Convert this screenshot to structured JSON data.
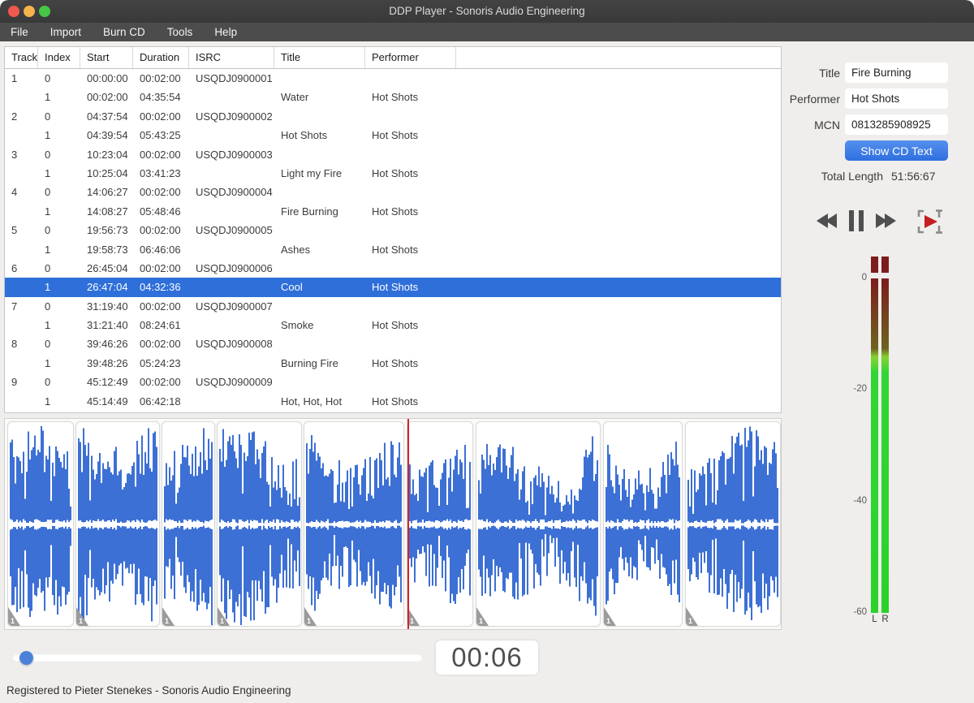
{
  "window": {
    "title": "DDP Player - Sonoris Audio Engineering"
  },
  "menu": {
    "items": [
      "File",
      "Import",
      "Burn CD",
      "Tools",
      "Help"
    ]
  },
  "table": {
    "columns": [
      "Track",
      "Index",
      "Start",
      "Duration",
      "ISRC",
      "Title",
      "Performer"
    ],
    "rows": [
      {
        "track": "1",
        "index": "0",
        "start": "00:00:00",
        "duration": "00:02:00",
        "isrc": "USQDJ0900001",
        "title": "",
        "performer": "",
        "selected": false
      },
      {
        "track": "",
        "index": "1",
        "start": "00:02:00",
        "duration": "04:35:54",
        "isrc": "",
        "title": "Water",
        "performer": "Hot Shots",
        "selected": false
      },
      {
        "track": "2",
        "index": "0",
        "start": "04:37:54",
        "duration": "00:02:00",
        "isrc": "USQDJ0900002",
        "title": "",
        "performer": "",
        "selected": false
      },
      {
        "track": "",
        "index": "1",
        "start": "04:39:54",
        "duration": "05:43:25",
        "isrc": "",
        "title": "Hot Shots",
        "performer": "Hot Shots",
        "selected": false
      },
      {
        "track": "3",
        "index": "0",
        "start": "10:23:04",
        "duration": "00:02:00",
        "isrc": "USQDJ0900003",
        "title": "",
        "performer": "",
        "selected": false
      },
      {
        "track": "",
        "index": "1",
        "start": "10:25:04",
        "duration": "03:41:23",
        "isrc": "",
        "title": "Light my Fire",
        "performer": "Hot Shots",
        "selected": false
      },
      {
        "track": "4",
        "index": "0",
        "start": "14:06:27",
        "duration": "00:02:00",
        "isrc": "USQDJ0900004",
        "title": "",
        "performer": "",
        "selected": false
      },
      {
        "track": "",
        "index": "1",
        "start": "14:08:27",
        "duration": "05:48:46",
        "isrc": "",
        "title": "Fire Burning",
        "performer": "Hot Shots",
        "selected": false
      },
      {
        "track": "5",
        "index": "0",
        "start": "19:56:73",
        "duration": "00:02:00",
        "isrc": "USQDJ0900005",
        "title": "",
        "performer": "",
        "selected": false
      },
      {
        "track": "",
        "index": "1",
        "start": "19:58:73",
        "duration": "06:46:06",
        "isrc": "",
        "title": "Ashes",
        "performer": "Hot Shots",
        "selected": false
      },
      {
        "track": "6",
        "index": "0",
        "start": "26:45:04",
        "duration": "00:02:00",
        "isrc": "USQDJ0900006",
        "title": "",
        "performer": "",
        "selected": false
      },
      {
        "track": "",
        "index": "1",
        "start": "26:47:04",
        "duration": "04:32:36",
        "isrc": "",
        "title": "Cool",
        "performer": "Hot Shots",
        "selected": true
      },
      {
        "track": "7",
        "index": "0",
        "start": "31:19:40",
        "duration": "00:02:00",
        "isrc": "USQDJ0900007",
        "title": "",
        "performer": "",
        "selected": false
      },
      {
        "track": "",
        "index": "1",
        "start": "31:21:40",
        "duration": "08:24:61",
        "isrc": "",
        "title": "Smoke",
        "performer": "Hot Shots",
        "selected": false
      },
      {
        "track": "8",
        "index": "0",
        "start": "39:46:26",
        "duration": "00:02:00",
        "isrc": "USQDJ0900008",
        "title": "",
        "performer": "",
        "selected": false
      },
      {
        "track": "",
        "index": "1",
        "start": "39:48:26",
        "duration": "05:24:23",
        "isrc": "",
        "title": "Burning Fire",
        "performer": "Hot Shots",
        "selected": false
      },
      {
        "track": "9",
        "index": "0",
        "start": "45:12:49",
        "duration": "00:02:00",
        "isrc": "USQDJ0900009",
        "title": "",
        "performer": "",
        "selected": false
      },
      {
        "track": "",
        "index": "1",
        "start": "45:14:49",
        "duration": "06:42:18",
        "isrc": "",
        "title": "Hot, Hot, Hot",
        "performer": "Hot Shots",
        "selected": false
      }
    ]
  },
  "side_panel": {
    "title_label": "Title",
    "title_value": "Fire Burning",
    "performer_label": "Performer",
    "performer_value": "Hot Shots",
    "mcn_label": "MCN",
    "mcn_value": "0813285908925",
    "show_cd_text_label": "Show CD Text",
    "total_length_label": "Total Length",
    "total_length_value": "51:56:67"
  },
  "transport": {
    "icons": [
      "rewind-icon",
      "pause-icon",
      "fast-forward-icon",
      "play-to-marker-icon"
    ]
  },
  "meter": {
    "scale_labels": [
      "0",
      "-20",
      "-40",
      "-60"
    ],
    "channel_labels": [
      "L",
      "R"
    ]
  },
  "waveform": {
    "marker_label": "1",
    "track_count": 9
  },
  "playback": {
    "time_display": "00:06"
  },
  "status_bar": {
    "text": "Registered to Pieter Stenekes - Sonoris Audio Engineering"
  },
  "colors": {
    "selection": "#2e6fd9",
    "accent_button": "#3d7de9",
    "waveform": "#3d70d5",
    "playhead": "#d0232b",
    "meter_green": "#2bd22b",
    "meter_clip": "#7c1c1c"
  }
}
